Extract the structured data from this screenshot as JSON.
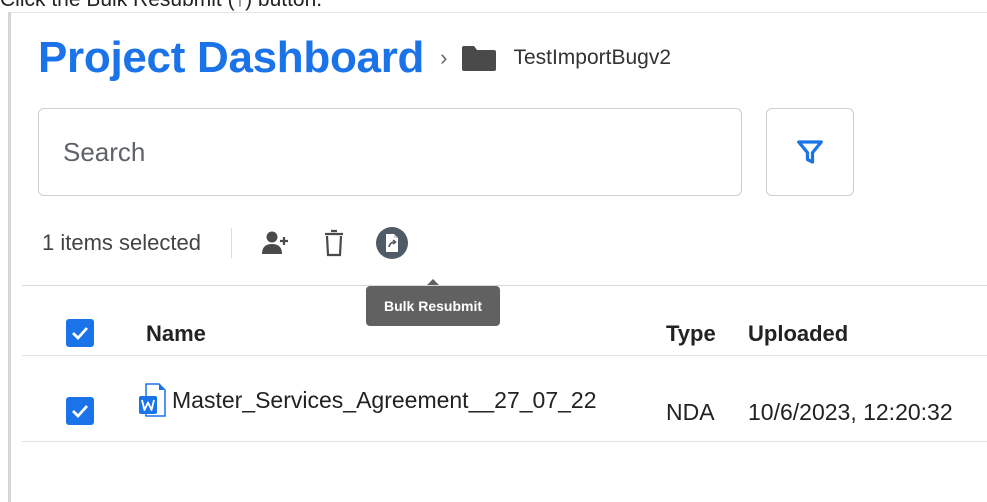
{
  "instruction": "Click the Bulk Resubmit (↑) button.",
  "header": {
    "title": "Project Dashboard",
    "separator": "›",
    "folder_name": "TestImportBugv2"
  },
  "search": {
    "placeholder": "Search",
    "value": ""
  },
  "selection": {
    "count_text": "1 items selected",
    "actions": [
      "add-user-icon",
      "trash-icon",
      "bulk-resubmit-icon"
    ]
  },
  "tooltip": {
    "text": "Bulk Resubmit"
  },
  "table": {
    "columns": [
      "Name",
      "Type",
      "Uploaded"
    ],
    "rows": [
      {
        "selected": true,
        "name": "Master_Services_Agreement__27_07_22",
        "type": "NDA",
        "uploaded": "10/6/2023, 12:20:32",
        "icon": "word-doc-icon"
      }
    ]
  },
  "colors": {
    "accent": "#1a73e8",
    "tooltip_bg": "#616161"
  }
}
